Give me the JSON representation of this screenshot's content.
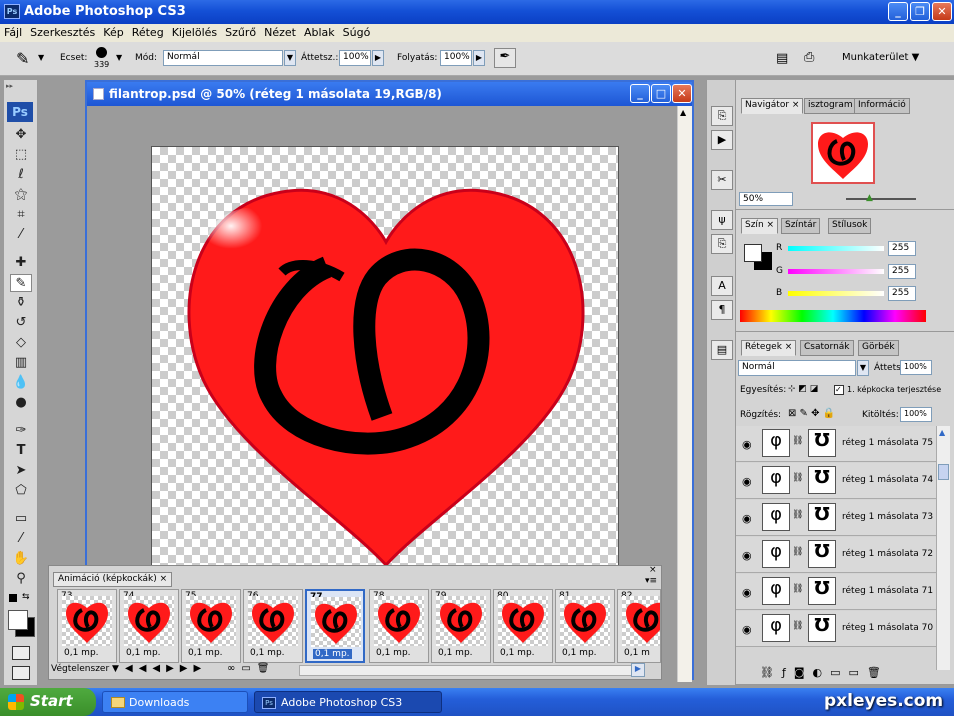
{
  "app": {
    "title": "Adobe Photoshop CS3",
    "icon": "Ps"
  },
  "menu": [
    "Fájl",
    "Szerkesztés",
    "Kép",
    "Réteg",
    "Kijelölés",
    "Szűrő",
    "Nézet",
    "Ablak",
    "Súgó"
  ],
  "options": {
    "brush_label": "Ecset:",
    "brush_size": "339",
    "mode_label": "Mód:",
    "mode_value": "Normál",
    "opacity_label": "Áttetsz.:",
    "opacity_value": "100%",
    "flow_label": "Folyatás:",
    "flow_value": "100%",
    "workspace_label": "Munkaterület"
  },
  "tools_label": "Ps",
  "document": {
    "title": "filantrop.psd @ 50% (réteg 1 másolata 19,RGB/8)"
  },
  "navigator": {
    "tabs": [
      "Navigátor",
      "isztogram",
      "Információ"
    ],
    "zoom": "50%"
  },
  "color_panel": {
    "tabs": [
      "Szín",
      "Színtár",
      "Stílusok"
    ],
    "r_label": "R",
    "r_value": "255",
    "g_label": "G",
    "g_value": "255",
    "b_label": "B",
    "b_value": "255"
  },
  "layers_panel": {
    "tabs": [
      "Rétegek",
      "Csatornák",
      "Görbék"
    ],
    "blend_mode": "Normál",
    "opacity_label": "Áttetsz.:",
    "opacity_value": "100%",
    "unify_label": "Egyesítés:",
    "propagate_label": "1. képkocka terjesztése",
    "lock_label": "Rögzítés:",
    "fill_label": "Kitöltés:",
    "fill_value": "100%",
    "layers": [
      {
        "name": "réteg 1 másolata 75"
      },
      {
        "name": "réteg 1 másolata 74"
      },
      {
        "name": "réteg 1 másolata 73"
      },
      {
        "name": "réteg 1 másolata 72"
      },
      {
        "name": "réteg 1 másolata 71"
      },
      {
        "name": "réteg 1 másolata 70"
      }
    ]
  },
  "animation": {
    "title": "Animáció (képkockák)",
    "frames": [
      {
        "num": "73",
        "dur": "0,1 mp."
      },
      {
        "num": "74",
        "dur": "0,1 mp."
      },
      {
        "num": "75",
        "dur": "0,1 mp."
      },
      {
        "num": "76",
        "dur": "0,1 mp."
      },
      {
        "num": "77",
        "dur": "0,1 mp."
      },
      {
        "num": "78",
        "dur": "0,1 mp."
      },
      {
        "num": "79",
        "dur": "0,1 mp."
      },
      {
        "num": "80",
        "dur": "0,1 mp."
      },
      {
        "num": "81",
        "dur": "0,1 mp."
      },
      {
        "num": "82",
        "dur": "0,1 m"
      }
    ],
    "loop": "Végtelenszer"
  },
  "taskbar": {
    "start": "Start",
    "items": [
      "Downloads",
      "Adobe Photoshop CS3"
    ]
  },
  "watermark": "pxleyes.com",
  "colors": {
    "heart": "#ff1a1a",
    "accent": "#2360d9"
  }
}
